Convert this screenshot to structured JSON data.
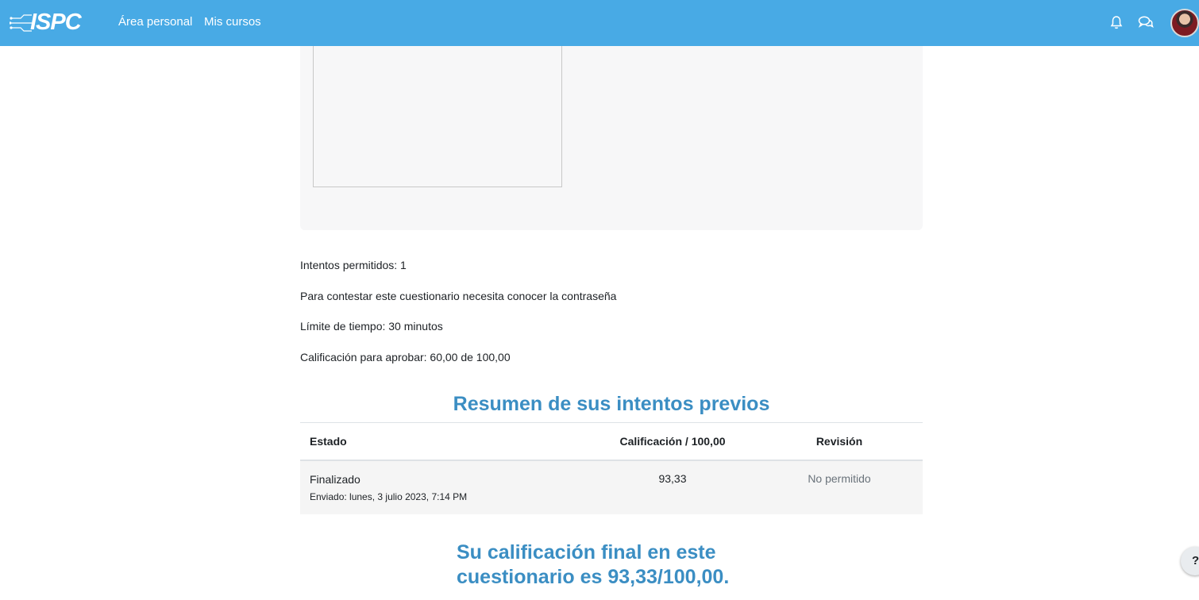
{
  "colors": {
    "navbar": "#48aae5",
    "heading": "#3b8ec3",
    "row_bg": "#f5f5f5",
    "intro_bg": "#f7f7f8"
  },
  "navbar": {
    "brand": "ISPC",
    "links": [
      "Área personal",
      "Mis cursos"
    ],
    "icons": [
      "bell-icon",
      "chat-icon"
    ]
  },
  "quiz_info": {
    "attempts_allowed": "Intentos permitidos: 1",
    "password_notice": "Para contestar este cuestionario necesita conocer la contraseña",
    "time_limit": "Límite de tiempo: 30 minutos",
    "pass_grade": "Calificación para aprobar: 60,00 de 100,00"
  },
  "summary": {
    "title": "Resumen de sus intentos previos",
    "headers": {
      "state": "Estado",
      "grade": "Calificación / 100,00",
      "review": "Revisión"
    },
    "rows": [
      {
        "state": "Finalizado",
        "submitted": "Enviado: lunes, 3 julio 2023, 7:14 PM",
        "grade": "93,33",
        "review": "No permitido"
      }
    ]
  },
  "final_grade": "Su calificación final en este cuestionario es 93,33/100,00.",
  "help_button": "?"
}
